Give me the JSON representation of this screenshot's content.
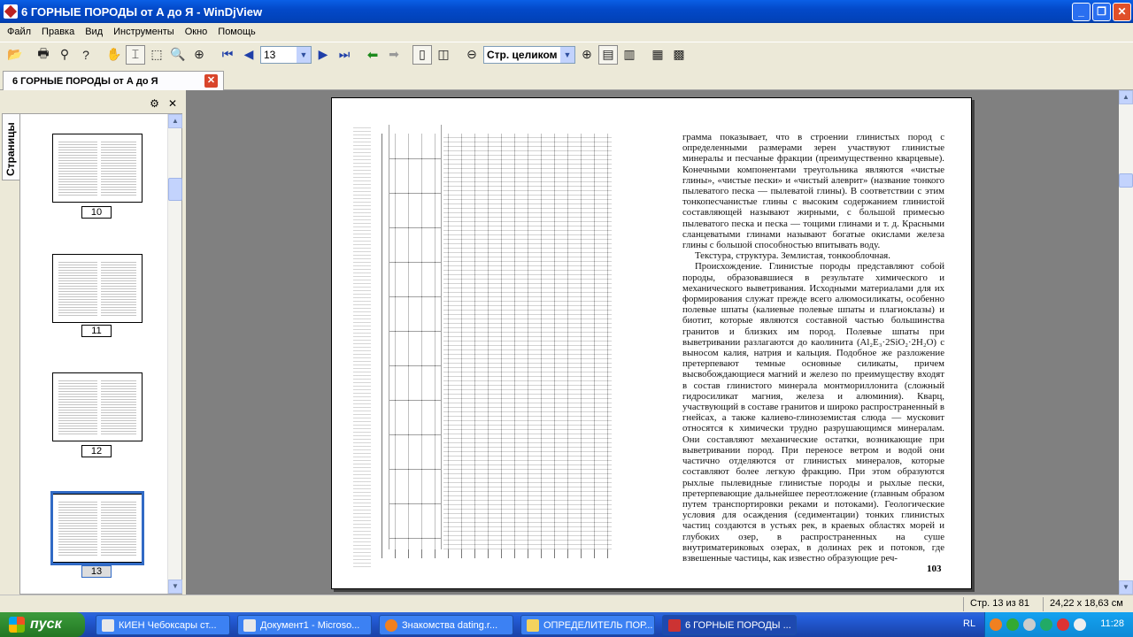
{
  "window": {
    "title": "6 ГОРНЫЕ ПОРОДЫ от А до Я - WinDjView"
  },
  "menu": [
    "Файл",
    "Правка",
    "Вид",
    "Инструменты",
    "Окно",
    "Помощь"
  ],
  "toolbar": {
    "page_value": "13",
    "zoom_value": "Стр. целиком"
  },
  "tab": {
    "label": "6 ГОРНЫЕ ПОРОДЫ от А до Я"
  },
  "sidepanel": {
    "tab_label": "Страницы",
    "thumbnails": [
      "10",
      "11",
      "12",
      "13"
    ],
    "selected": "13"
  },
  "document": {
    "page_number": "103",
    "paragraphs": [
      "грамма показывает, что в строении глинистых пород с определенными размерами зерен участвуют глинистые минералы и песчаные фракции (преимущественно кварцевые). Конечными компонентами треугольника являются «чистые глины», «чистые пески» и «чистый алеврит» (название тонкого пылеватого песка — пылеватой глины). В соответствии с этим тонкопесчанистые глины с высоким содержанием глинистой составляющей называют жирными, с большой примесью пылеватого песка и песка — тощими глинами и т. д. Красными сланцеватыми глинами называют богатые окислами железа глины с большой способностью впитывать воду.",
      "Текстура, структура. Землистая, тонкооблочная.",
      "Происхождение. Глинистые породы представляют собой породы, образовавшиеся в результате химического и механического выветривания. Исходными материалами для их формирования служат прежде всего алюмосиликаты, особенно полевые шпаты (калиевые полевые шпаты и плагиоклазы) и биотит, которые являются составной частью большинства гранитов и близких им пород. Полевые шпаты при выветривании разлагаются до каолинита (Al₂E₃·2SiO₂·2H₂O) с выносом калия, натрия и кальция. Подобное же разложение претерпевают темные основные силикаты, причем высвобождающиеся магний и железо по преимуществу входят в состав глинистого минерала монтмориллонита (сложный гидросиликат магния, железа и алюминия). Кварц, участвующий в составе гранитов и широко распространенный в гнейсах, а также калиево-глиноземистая слюда — мусковит относятся к химически трудно разрушающимся минералам. Они составляют механические остатки, возникающие при выветривании пород. При переносе ветром и водой они частично отделяются от глинистых минералов, которые составляют более легкую фракцию. При этом образуются рыхлые пылевидные глинистые породы и рыхлые пески, претерпевающие дальнейшее переотложение (главным образом путем транспортировки реками и потоками). Геологические условия для осаждения (седиментации) тонких глинистых частиц создаются в устьях рек, в краевых областях морей и глубоких озер, в распространенных на суше внутриматериковых озерах, в долинах рек и потоков, где взвешенные частицы, как известно образующие реч-"
    ]
  },
  "status": {
    "page": "Стр. 13 из 81",
    "size": "24,22 x 18,63 см"
  },
  "taskbar": {
    "start": "пуск",
    "tasks": [
      "КИЕН Чебоксары ст...",
      "Документ1 - Microso...",
      "Знакомства dating.r...",
      "ОПРЕДЕЛИТЕЛЬ ПОР...",
      "6 ГОРНЫЕ ПОРОДЫ ..."
    ],
    "lang": "RL",
    "clock": "11:28"
  }
}
